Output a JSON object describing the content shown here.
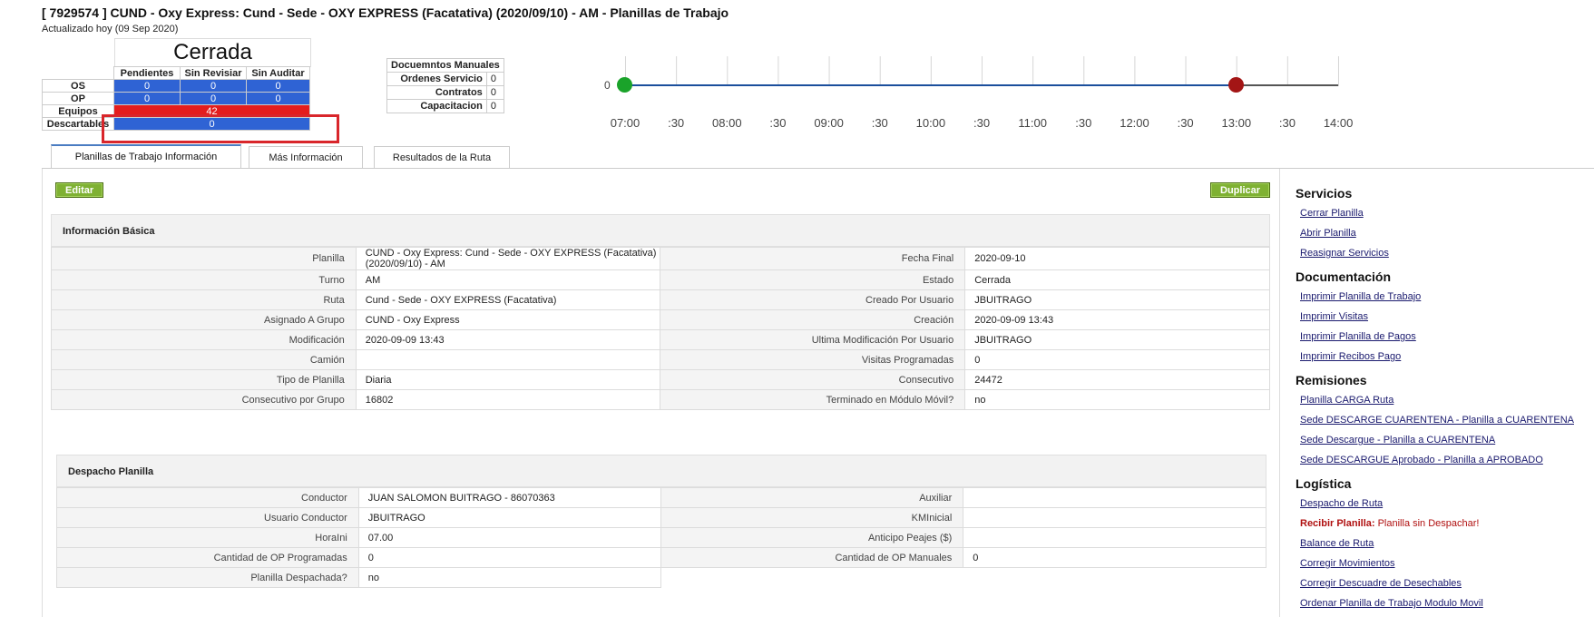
{
  "header": {
    "title": "[ 7929574 ] CUND - Oxy Express: Cund - Sede - OXY EXPRESS (Facatativa) (2020/09/10) - AM - Planillas de Trabajo",
    "updated": "Actualizado hoy (09 Sep 2020)"
  },
  "status": {
    "state": "Cerrada",
    "columns": [
      "Pendientes",
      "Sin Revisiar",
      "Sin Auditar"
    ],
    "rows": [
      {
        "label": "OS",
        "values": [
          "0",
          "0",
          "0"
        ]
      },
      {
        "label": "OP",
        "values": [
          "0",
          "0",
          "0"
        ]
      }
    ],
    "equipos": {
      "label": "Equipos",
      "value": "42"
    },
    "descartables": {
      "label": "Descartables",
      "value": "0"
    }
  },
  "manual_docs": {
    "title": "Docuemntos Manuales",
    "rows": [
      {
        "label": "Ordenes Servicio",
        "value": "0"
      },
      {
        "label": "Contratos",
        "value": "0"
      },
      {
        "label": "Capacitacion",
        "value": "0"
      }
    ]
  },
  "timeline": {
    "start_value": "0",
    "ticks": [
      "07:00",
      ":30",
      "08:00",
      ":30",
      "09:00",
      ":30",
      "10:00",
      ":30",
      "11:00",
      ":30",
      "12:00",
      ":30",
      "13:00",
      ":30",
      "14:00"
    ],
    "start_marker": "07:00",
    "end_marker": "13:00",
    "colors": {
      "start": "#1aa32a",
      "end": "#a31515",
      "line": "#1b4f9c"
    }
  },
  "tabs": [
    {
      "label": "Planillas de Trabajo Información",
      "active": true
    },
    {
      "label": "Más Información",
      "active": false
    },
    {
      "label": "Resultados de la Ruta",
      "active": false
    }
  ],
  "actions": {
    "edit": "Editar",
    "duplicate": "Duplicar"
  },
  "basic_info": {
    "title": "Información Básica",
    "rows": [
      {
        "k1": "Planilla",
        "v1": "CUND - Oxy Express: Cund - Sede - OXY EXPRESS (Facatativa) (2020/09/10) - AM",
        "k2": "Fecha Final",
        "v2": "2020-09-10"
      },
      {
        "k1": "Turno",
        "v1": "AM",
        "k2": "Estado",
        "v2": "Cerrada"
      },
      {
        "k1": "Ruta",
        "v1": "Cund - Sede - OXY EXPRESS (Facatativa)",
        "k2": "Creado Por Usuario",
        "v2": "JBUITRAGO"
      },
      {
        "k1": "Asignado A Grupo",
        "v1": "CUND - Oxy Express",
        "k2": "Creación",
        "v2": "2020-09-09 13:43"
      },
      {
        "k1": "Modificación",
        "v1": "2020-09-09 13:43",
        "k2": "Ultima Modificación Por Usuario",
        "v2": "JBUITRAGO"
      },
      {
        "k1": "Camión",
        "v1": "",
        "k2": "Visitas Programadas",
        "v2": "0"
      },
      {
        "k1": "Tipo de Planilla",
        "v1": "Diaria",
        "k2": "Consecutivo",
        "v2": "24472"
      },
      {
        "k1": "Consecutivo por Grupo",
        "v1": "16802",
        "k2": "Terminado en Módulo Móvil?",
        "v2": "no"
      }
    ]
  },
  "dispatch": {
    "title": "Despacho Planilla",
    "rows": [
      {
        "k1": "Conductor",
        "v1": "JUAN SALOMON BUITRAGO - 86070363",
        "k2": "Auxiliar",
        "v2": ""
      },
      {
        "k1": "Usuario Conductor",
        "v1": "JBUITRAGO",
        "k2": "KMInicial",
        "v2": ""
      },
      {
        "k1": "HoraIni",
        "v1": "07.00",
        "k2": "Anticipo Peajes ($)",
        "v2": ""
      },
      {
        "k1": "Cantidad de OP Programadas",
        "v1": "0",
        "k2": "Cantidad de OP Manuales",
        "v2": "0"
      },
      {
        "k1": "Planilla Despachada?",
        "v1": "no"
      }
    ]
  },
  "sidebar": {
    "sections": [
      {
        "title": "Servicios",
        "links": [
          "Cerrar Planilla",
          "Abrir Planilla",
          "Reasignar Servicios"
        ]
      },
      {
        "title": "Documentación",
        "links": [
          "Imprimir Planilla de Trabajo",
          "Imprimir Visitas",
          "Imprimir Planilla de Pagos",
          "Imprimir Recibos Pago"
        ]
      },
      {
        "title": "Remisiones",
        "links": [
          "Planilla CARGA Ruta",
          "Sede DESCARGE CUARENTENA - Planilla a CUARENTENA",
          "Sede Descargue - Planilla a CUARENTENA",
          "Sede DESCARGUE Aprobado - Planilla a APROBADO"
        ]
      },
      {
        "title": "Logística",
        "links": [
          "Despacho de Ruta"
        ],
        "warning": {
          "label": "Recibir Planilla:",
          "text": "Planilla sin Despachar!"
        },
        "links_after": [
          "Balance de Ruta",
          "Corregir Movimientos",
          "Corregir Descuadre de Desechables",
          "Ordenar Planilla de Trabajo Modulo Movil"
        ]
      }
    ]
  }
}
